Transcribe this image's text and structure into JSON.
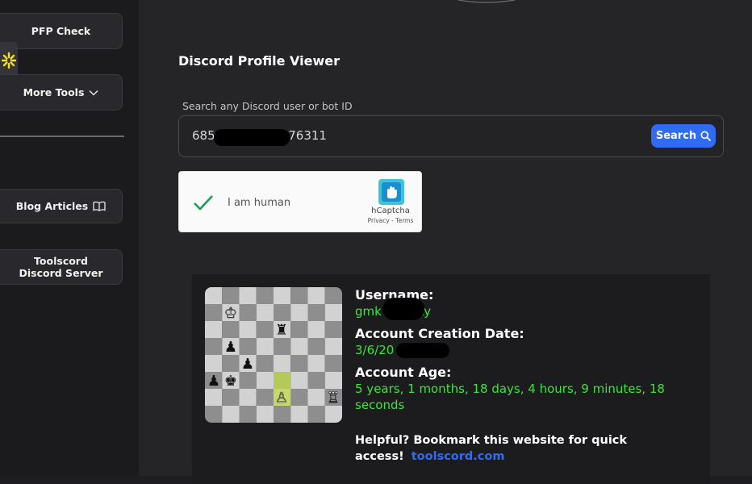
{
  "sidebar": {
    "items": [
      {
        "label": "PFP Check"
      },
      {
        "label": "More Tools"
      },
      {
        "label": "Blog Articles"
      },
      {
        "label": "Toolscord Discord Server"
      }
    ]
  },
  "main": {
    "title": "Discord Profile Viewer",
    "search": {
      "label": "Search any Discord user or bot ID",
      "value": "685                 076311",
      "button": "Search"
    },
    "captcha": {
      "label": "I am human",
      "brand": "hCaptcha",
      "links": "Privacy - Terms"
    },
    "result": {
      "username_label": "Username:",
      "username_value": "gmk         polvsky",
      "created_label": "Account Creation Date:",
      "created_value": "3/6/20                :46 PM",
      "age_label": "Account Age:",
      "age_value": "5 years, 1 months, 18 days, 4 hours, 9 minutes, 18 seconds",
      "helpful_text": "Helpful? Bookmark this website for quick access!",
      "site_link": "toolscord.com"
    }
  },
  "colors": {
    "accent": "#2f6bf5",
    "value_green": "#3fe23f",
    "captcha_check": "#1b9e50"
  }
}
